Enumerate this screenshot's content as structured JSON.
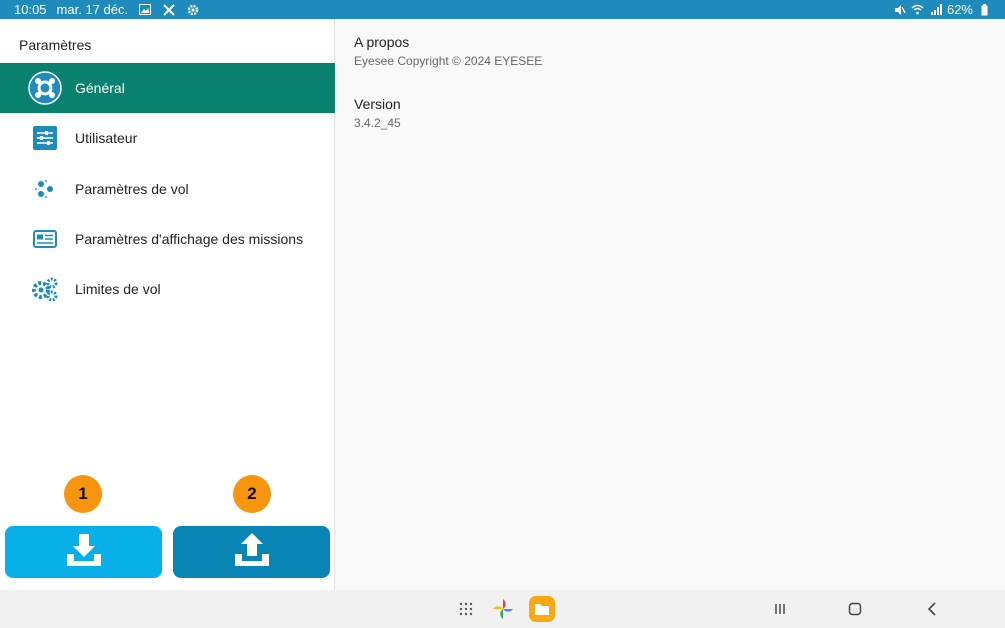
{
  "status_bar": {
    "time": "10:05",
    "date": "mar. 17 déc.",
    "battery": "62%",
    "icons": [
      "gallery-icon",
      "tools-icon",
      "settings-icon",
      "mute-icon",
      "wifi-icon",
      "signal-icon",
      "battery-icon"
    ]
  },
  "sidebar": {
    "title": "Paramètres",
    "items": [
      {
        "label": "Général",
        "icon": "general-icon",
        "active": true
      },
      {
        "label": "Utilisateur",
        "icon": "user-sliders-icon",
        "active": false
      },
      {
        "label": "Paramètres de vol",
        "icon": "flight-params-icon",
        "active": false
      },
      {
        "label": "Paramètres d'affichage des missions",
        "icon": "mission-display-icon",
        "active": false
      },
      {
        "label": "Limites de vol",
        "icon": "flight-limits-gears-icon",
        "active": false
      }
    ]
  },
  "actions": {
    "download": {
      "badge": "1",
      "icon": "download-icon"
    },
    "upload": {
      "badge": "2",
      "icon": "upload-icon"
    }
  },
  "main": {
    "about": {
      "title": "A propos",
      "text": "Eyesee Copyright © 2024 EYESEE"
    },
    "version": {
      "title": "Version",
      "text": "3.4.2_45"
    }
  },
  "nav_bar": {
    "icons": [
      "apps-grid-icon",
      "photos-app-icon",
      "files-app-icon",
      "recents-icon",
      "home-icon",
      "back-icon"
    ]
  },
  "colors": {
    "status_bar": "#1f8bbd",
    "active_item": "#08826e",
    "download_button": "#08b0e9",
    "upload_button": "#0884b5",
    "badge": "#f7950f"
  }
}
